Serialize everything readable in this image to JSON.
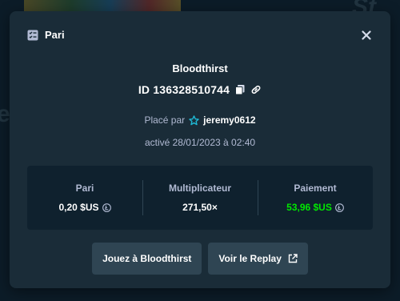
{
  "modal": {
    "title": "Pari",
    "game_name": "Bloodthirst",
    "bet_id": "ID 136328510744",
    "placed_by_label": "Placé par",
    "username": "jeremy0612",
    "activated": "activé 28/01/2023 à 02:40"
  },
  "stats": [
    {
      "label": "Pari",
      "value": "0,20 $US",
      "icon": "litecoin-icon"
    },
    {
      "label": "Multiplicateur",
      "value": "271,50×"
    },
    {
      "label": "Paiement",
      "value": "53,96 $US",
      "icon": "litecoin-icon"
    }
  ],
  "actions": {
    "play_label": "Jouez à Bloodthirst",
    "replay_label": "Voir le Replay"
  },
  "colors": {
    "background": "#0f212e",
    "modal": "#1a2c38",
    "button": "#2f4553",
    "muted_text": "#b1bad3",
    "payout_green": "#00e701",
    "vip_star": "#1fb8d4"
  }
}
